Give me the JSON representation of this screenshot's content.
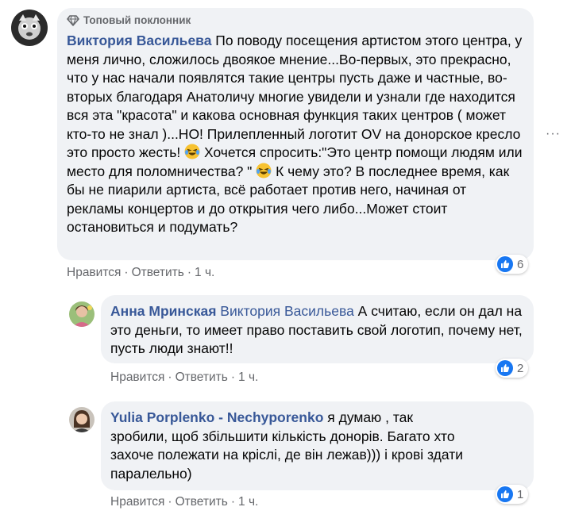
{
  "colors": {
    "author": "#385898",
    "bubble": "#f0f2f5",
    "meta": "#65676b",
    "like": "#1877f2"
  },
  "comments": [
    {
      "badge": "Топовый поклонник",
      "author": "Виктория Васильева",
      "text_1": " По поводу посещения артистом этого центра, у меня лично, сложилось двоякое мнение...Во-первых, это прекрасно, что у нас начали появлятся такие центры пусть даже и частные, во-вторых благодаря Анатоличу многие увидели и узнали где находится вся эта \"красота\" и какова основная функция таких центров ( может кто-то не знал )...НО! Прилепленный логотит OV на донорское кресло это просто жесть! ",
      "text_2": " Хочется спросить:\"Это центр помощи людям или место для поломничества? \" ",
      "text_3": " К чему это? В последнее время, как бы не пиарили артиста, всё работает против него, начиная от рекламы концертов и до открытия чего либо...Может стоит остановиться и подумать?",
      "emoji": "laughing-crying-emoji",
      "like_label": "Нравится",
      "reply_label": "Ответить",
      "time": "1 ч.",
      "reactions": "6"
    },
    {
      "author": "Анна Мринская",
      "mention": "Виктория Васильева",
      "text": " А считаю, если он дал на это деньги, то имеет право поставить свой логотип, почему нет, пусть люди знают!!",
      "like_label": "Нравится",
      "reply_label": "Ответить",
      "time": "1 ч.",
      "reactions": "2"
    },
    {
      "author": "Yulia Porplenko - Nechyporenko",
      "text": " я думаю , так зробили, щоб збільшити кількість донорів. Багато хто захоче полежати на кріслі, де він лежав))) і крові здати паралельно)",
      "like_label": "Нравится",
      "reply_label": "Ответить",
      "time": "1 ч.",
      "reactions": "1"
    }
  ],
  "separator": "·",
  "more_menu": "···"
}
